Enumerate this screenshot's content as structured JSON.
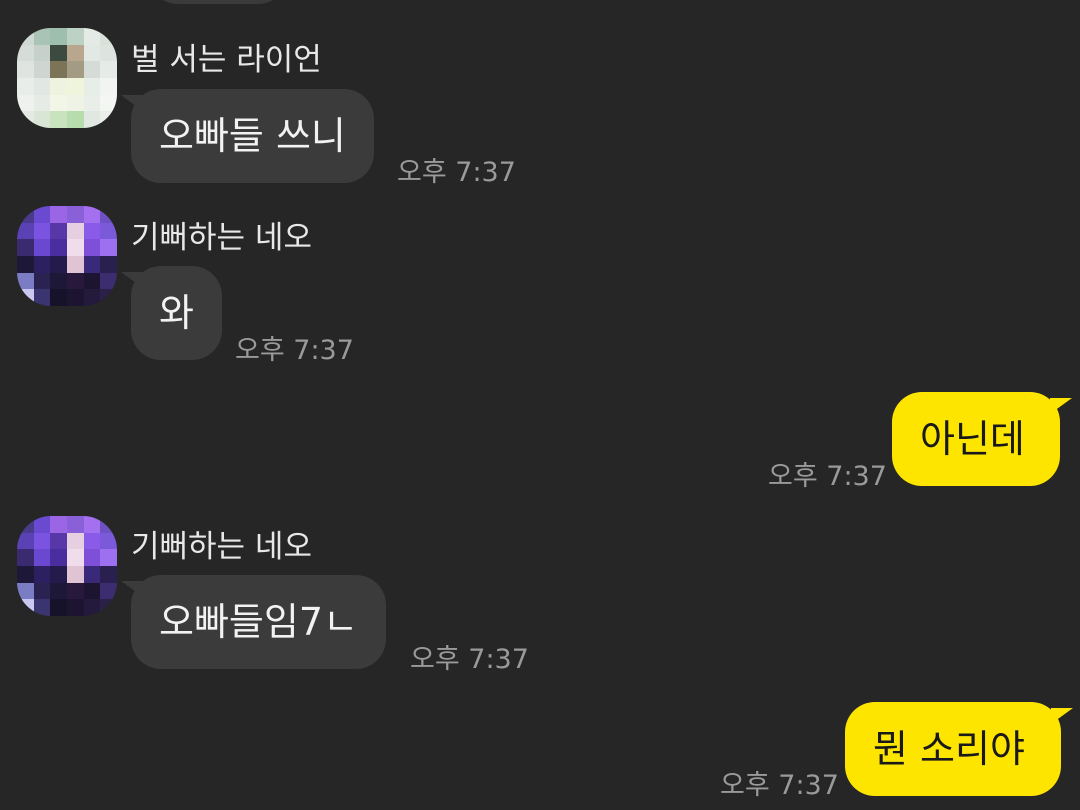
{
  "messages": [
    {
      "sender": "벌 서는 라이언",
      "text": "오빠들 쓰니",
      "time": "오후 7:37"
    },
    {
      "sender": "기뻐하는 네오",
      "text": "와",
      "time": "오후 7:37"
    },
    {
      "text": "아닌데",
      "time": "오후 7:37"
    },
    {
      "sender": "기뻐하는 네오",
      "text": "오빠들임7ㄴ",
      "time": "오후 7:37"
    },
    {
      "text": "뭔 소리야",
      "time": "오후 7:37"
    }
  ],
  "colors": {
    "background": "#262626",
    "incoming_bubble": "#3b3b3b",
    "outgoing_bubble": "#fee500",
    "timestamp": "#9a9a9a"
  }
}
